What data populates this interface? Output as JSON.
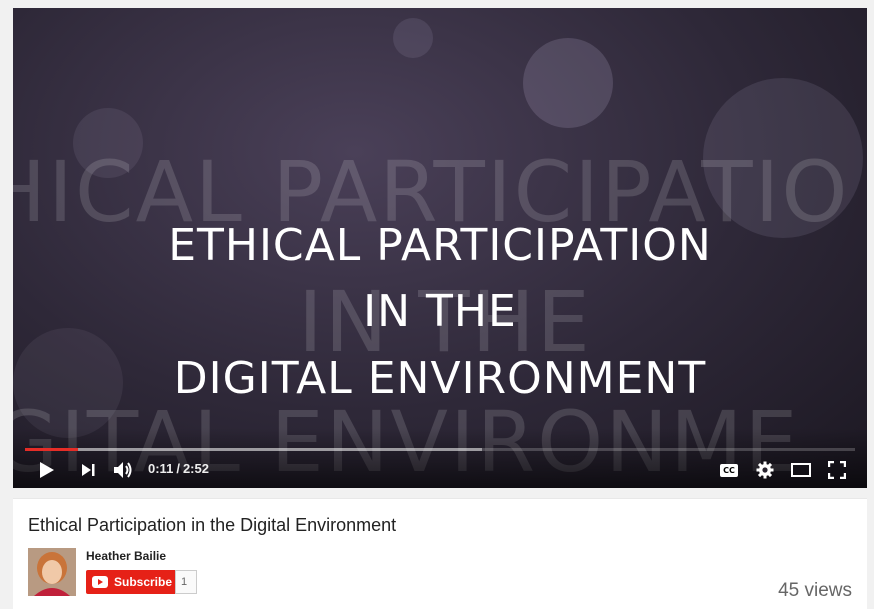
{
  "player": {
    "background_text": {
      "line1": "HICAL PARTICIPATIO",
      "line2": "IN THE",
      "line3": "GITAL ENVIRONME"
    },
    "title_card": {
      "line1": "ETHICAL PARTICIPATION",
      "line2": "IN THE",
      "line3": "DIGITAL ENVIRONMENT"
    },
    "controls": {
      "current_time": "0:11",
      "separator": "/",
      "duration": "2:52",
      "progress_played_fraction": 0.064,
      "progress_buffered_fraction": 0.55,
      "icons": [
        "play-icon",
        "next-icon",
        "volume-icon",
        "captions-icon",
        "settings-icon",
        "theater-mode-icon",
        "fullscreen-icon"
      ],
      "captions_label": "CC"
    },
    "accent_color": "#e52d27"
  },
  "video": {
    "title": "Ethical Participation in the Digital Environment",
    "channel_name": "Heather Bailie",
    "subscribe_label": "Subscribe",
    "subscriber_count": "1",
    "views": "45 views"
  }
}
